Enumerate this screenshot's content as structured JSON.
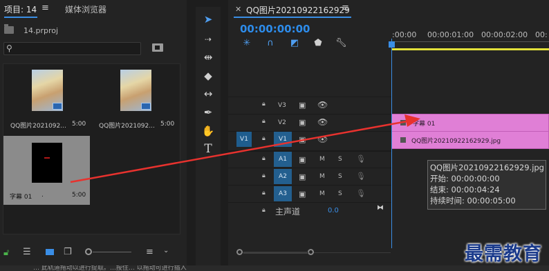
{
  "project_panel": {
    "tab_active": "项目: 14",
    "tab_menu_icon": "≡",
    "tab_media_browser": "媒体浏览器",
    "project_file": "14.prproj",
    "search_placeholder": "",
    "items": [
      {
        "name": "QQ图片2021092...",
        "duration": "5:00"
      },
      {
        "name": "QQ图片2021092...",
        "duration": "5:00"
      },
      {
        "name": "字幕 01",
        "duration": "5:00"
      }
    ]
  },
  "tools": [
    "selection-tool",
    "track-select-tool",
    "ripple-edit-tool",
    "razor-tool",
    "slip-tool",
    "pen-tool",
    "hand-tool",
    "type-tool"
  ],
  "timeline": {
    "title": "QQ图片20210922162929",
    "menu_icon": "≡",
    "timecode": "00:00:00:00",
    "ruler_labels": [
      ":00:00",
      "00:00:01:00",
      "00:00:02:00",
      "00:"
    ],
    "tracks": {
      "v3": "V3",
      "v2": "V2",
      "v1_source": "V1",
      "v1": "V1",
      "a1": "A1",
      "a2": "A2",
      "a3": "A3",
      "master_label": "主声道",
      "master_value": "0.0",
      "m_label": "M",
      "s_label": "S"
    },
    "clips": {
      "v2_clip": "字幕 01",
      "v1_clip": "QQ图片20210922162929.jpg"
    },
    "tooltip": {
      "line1": "QQ图片20210922162929.jpg",
      "line2": "开始: 00:00:00:00",
      "line3": "结束: 00:00:04:24",
      "line4": "持续时间: 00:00:05:00"
    }
  },
  "watermark": "最需教育",
  "status_bar": "… 此轨道拖动以进行提取。…按住… 以拖动可进行插入",
  "colors": {
    "accent_blue": "#2d8ceb",
    "clip_pink": "#e07fd6",
    "playhead": "#3a8ee6",
    "annotation_arrow": "#e8322e",
    "work_area_bar": "#e3e13a"
  }
}
